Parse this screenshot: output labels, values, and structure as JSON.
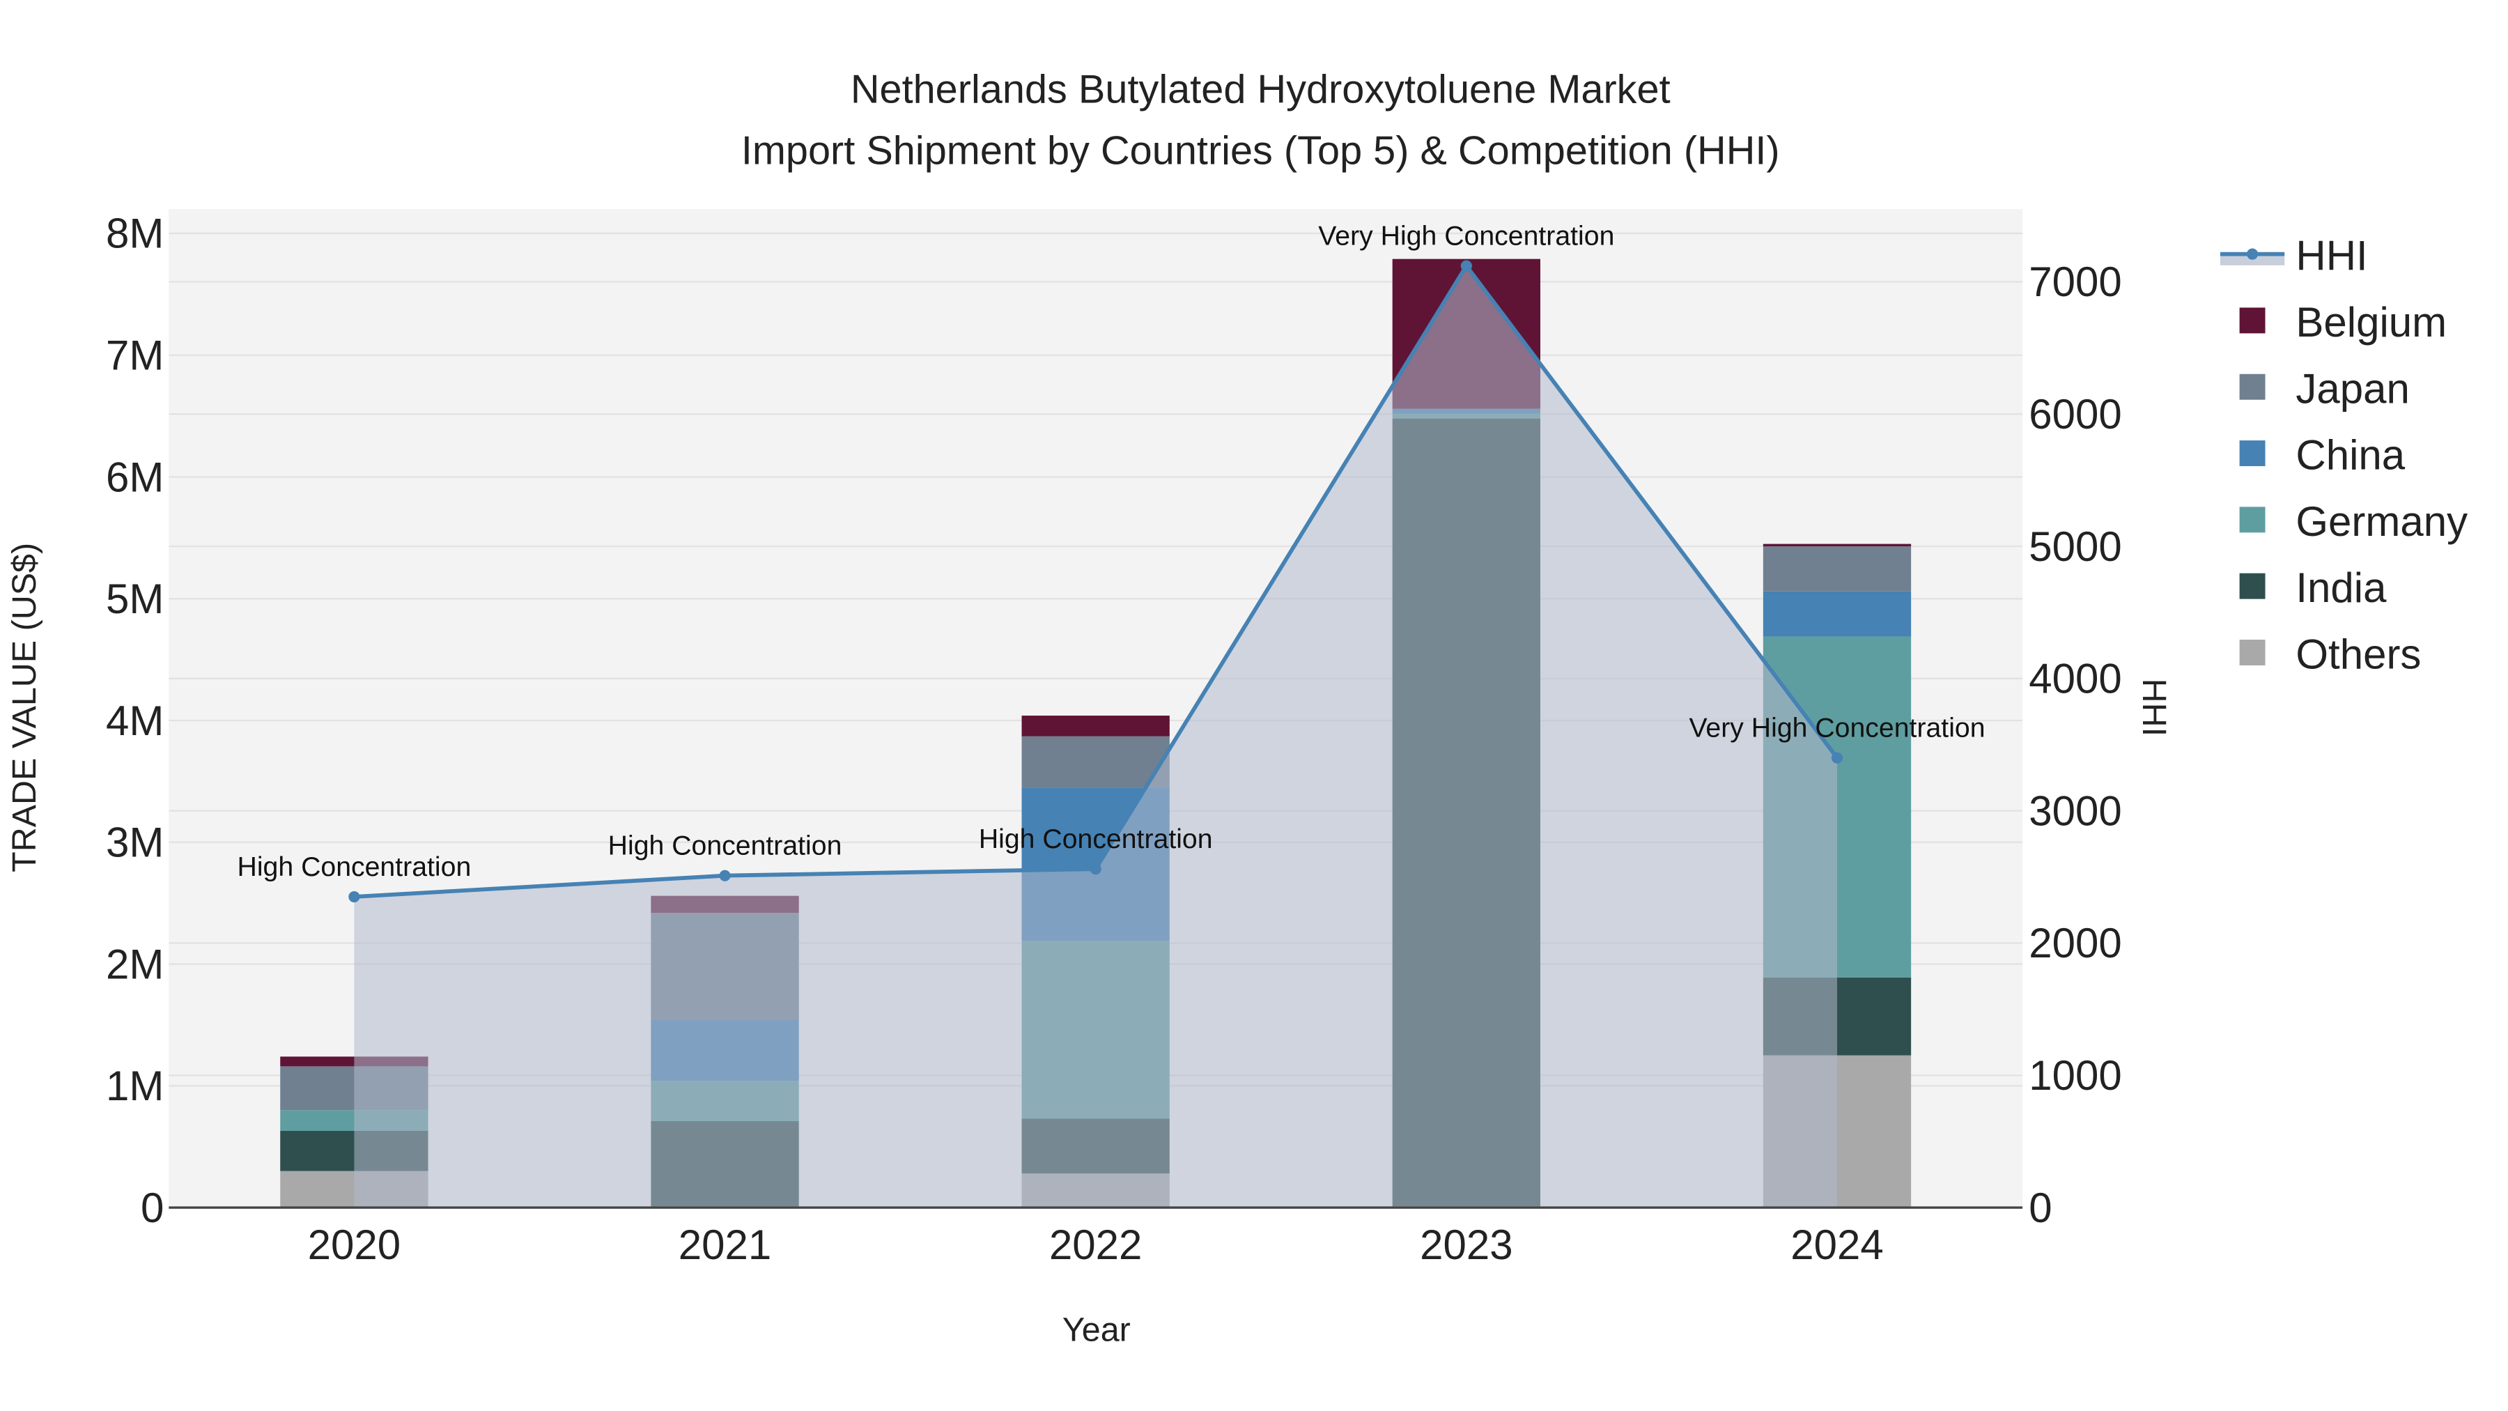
{
  "chart_data": {
    "type": "bar",
    "stacked": true,
    "title": "Netherlands Butylated Hydroxytoluene Market",
    "subtitle": "Import Shipment by Countries (Top 5) & Competition (HHI)",
    "xlabel": "Year",
    "ylabel": "TRADE VALUE (US$)",
    "y2label": "HHI",
    "categories": [
      "2020",
      "2021",
      "2022",
      "2023",
      "2024"
    ],
    "ylim": [
      0,
      8200000
    ],
    "y2lim": [
      0,
      7550
    ],
    "yticks": [
      0,
      1000000,
      2000000,
      3000000,
      4000000,
      5000000,
      6000000,
      7000000,
      8000000
    ],
    "ytick_labels": [
      "0",
      "1M",
      "2M",
      "3M",
      "4M",
      "5M",
      "6M",
      "7M",
      "8M"
    ],
    "y2ticks": [
      0,
      1000,
      2000,
      3000,
      4000,
      5000,
      6000,
      7000
    ],
    "y2tick_labels": [
      "0",
      "1000",
      "2000",
      "3000",
      "4000",
      "5000",
      "6000",
      "7000"
    ],
    "grid": true,
    "legend_position": "right",
    "series": [
      {
        "name": "Others",
        "color": "#a9a9a9",
        "values": [
          300000,
          10000,
          280000,
          10000,
          1250000
        ]
      },
      {
        "name": "India",
        "color": "#2f4f4f",
        "values": [
          330000,
          700000,
          450000,
          6470000,
          640000
        ]
      },
      {
        "name": "Germany",
        "color": "#5f9ea0",
        "values": [
          170000,
          330000,
          1460000,
          40000,
          2800000
        ]
      },
      {
        "name": "China",
        "color": "#4682b4",
        "values": [
          0,
          500000,
          1260000,
          40000,
          370000
        ]
      },
      {
        "name": "Japan",
        "color": "#708090",
        "values": [
          360000,
          880000,
          420000,
          0,
          370000
        ]
      },
      {
        "name": "Belgium",
        "color": "#5f1436",
        "values": [
          80000,
          140000,
          170000,
          1230000,
          20000
        ]
      }
    ],
    "hhi": {
      "name": "HHI",
      "color": "#4682b4",
      "values": [
        2350,
        2510,
        2560,
        7120,
        3400
      ],
      "annotations": [
        "High Concentration",
        "High Concentration",
        "High Concentration",
        "Very High Concentration",
        "Very High Concentration"
      ]
    },
    "legend_order": [
      "HHI",
      "Belgium",
      "Japan",
      "China",
      "Germany",
      "India",
      "Others"
    ]
  }
}
